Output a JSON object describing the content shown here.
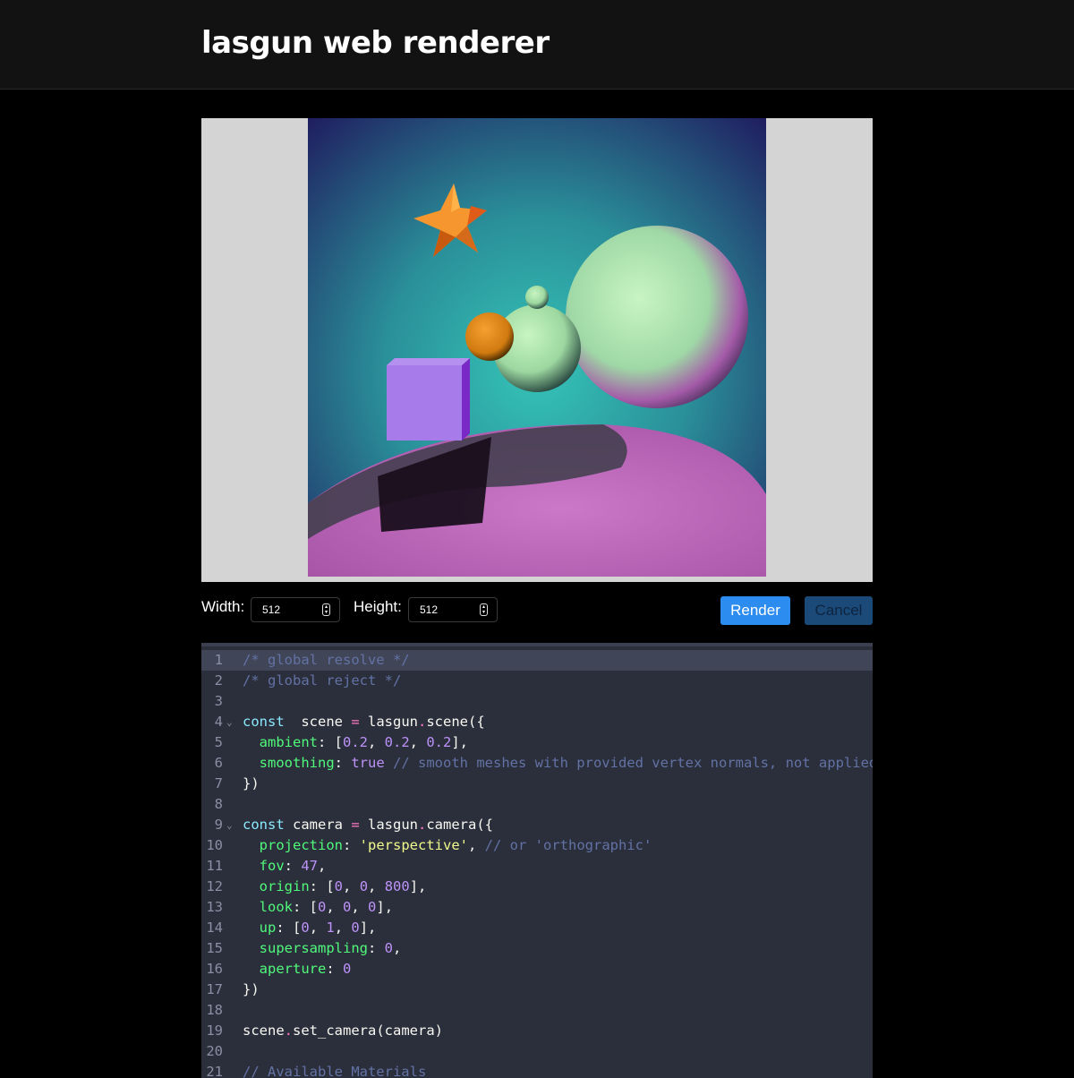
{
  "header": {
    "title": "lasgun web renderer"
  },
  "render": {
    "colors": {
      "sky_top": "#1f1b5e",
      "sky_mid": "#2a9b9c",
      "ground": "#c770c5",
      "star": "#f5962e",
      "cube": "#a77bea",
      "sphere_light": "#b6f0b4",
      "orange_ball": "#e88a1c"
    }
  },
  "controls": {
    "width_label": "Width:",
    "width_value": "512",
    "height_label": "Height:",
    "height_value": "512",
    "render_label": "Render",
    "cancel_label": "Cancel"
  },
  "editor": {
    "lines": [
      [
        [
          "c-cm",
          "/* global resolve */"
        ]
      ],
      [
        [
          "c-cm",
          "/* global reject */"
        ]
      ],
      [],
      [
        [
          "c-kw",
          "const"
        ],
        [
          "",
          "  scene "
        ],
        [
          "c-op",
          "="
        ],
        [
          "",
          " lasgun"
        ],
        [
          "c-op",
          "."
        ],
        [
          "",
          "scene({"
        ]
      ],
      [
        [
          "",
          "  "
        ],
        [
          "c-pr",
          "ambient"
        ],
        [
          "",
          ": ["
        ],
        [
          "c-nu",
          "0.2"
        ],
        [
          "",
          ", "
        ],
        [
          "c-nu",
          "0.2"
        ],
        [
          "",
          ", "
        ],
        [
          "c-nu",
          "0.2"
        ],
        [
          "",
          "],"
        ]
      ],
      [
        [
          "",
          "  "
        ],
        [
          "c-pr",
          "smoothing"
        ],
        [
          "",
          ": "
        ],
        [
          "c-nu",
          "true"
        ],
        [
          "c-cm",
          " // smooth meshes with provided vertex normals, not applied"
        ]
      ],
      [
        [
          "",
          "})"
        ]
      ],
      [],
      [
        [
          "c-kw",
          "const"
        ],
        [
          "",
          " camera "
        ],
        [
          "c-op",
          "="
        ],
        [
          "",
          " lasgun"
        ],
        [
          "c-op",
          "."
        ],
        [
          "",
          "camera({"
        ]
      ],
      [
        [
          "",
          "  "
        ],
        [
          "c-pr",
          "projection"
        ],
        [
          "",
          ": "
        ],
        [
          "c-st",
          "'perspective'"
        ],
        [
          "",
          ", "
        ],
        [
          "c-cm",
          "// or 'orthographic'"
        ]
      ],
      [
        [
          "",
          "  "
        ],
        [
          "c-pr",
          "fov"
        ],
        [
          "",
          ": "
        ],
        [
          "c-nu",
          "47"
        ],
        [
          "",
          ","
        ]
      ],
      [
        [
          "",
          "  "
        ],
        [
          "c-pr",
          "origin"
        ],
        [
          "",
          ": ["
        ],
        [
          "c-nu",
          "0"
        ],
        [
          "",
          ", "
        ],
        [
          "c-nu",
          "0"
        ],
        [
          "",
          ", "
        ],
        [
          "c-nu",
          "800"
        ],
        [
          "",
          "],"
        ]
      ],
      [
        [
          "",
          "  "
        ],
        [
          "c-pr",
          "look"
        ],
        [
          "",
          ": ["
        ],
        [
          "c-nu",
          "0"
        ],
        [
          "",
          ", "
        ],
        [
          "c-nu",
          "0"
        ],
        [
          "",
          ", "
        ],
        [
          "c-nu",
          "0"
        ],
        [
          "",
          "],"
        ]
      ],
      [
        [
          "",
          "  "
        ],
        [
          "c-pr",
          "up"
        ],
        [
          "",
          ": ["
        ],
        [
          "c-nu",
          "0"
        ],
        [
          "",
          ", "
        ],
        [
          "c-nu",
          "1"
        ],
        [
          "",
          ", "
        ],
        [
          "c-nu",
          "0"
        ],
        [
          "",
          "],"
        ]
      ],
      [
        [
          "",
          "  "
        ],
        [
          "c-pr",
          "supersampling"
        ],
        [
          "",
          ": "
        ],
        [
          "c-nu",
          "0"
        ],
        [
          "",
          ","
        ]
      ],
      [
        [
          "",
          "  "
        ],
        [
          "c-pr",
          "aperture"
        ],
        [
          "",
          ": "
        ],
        [
          "c-nu",
          "0"
        ]
      ],
      [
        [
          "",
          "})"
        ]
      ],
      [],
      [
        [
          "",
          "scene"
        ],
        [
          "c-op",
          "."
        ],
        [
          "",
          "set_camera(camera)"
        ]
      ],
      [],
      [
        [
          "c-cm",
          "// Available Materials"
        ]
      ]
    ],
    "folds": [
      4,
      9
    ],
    "active_line": 1
  }
}
